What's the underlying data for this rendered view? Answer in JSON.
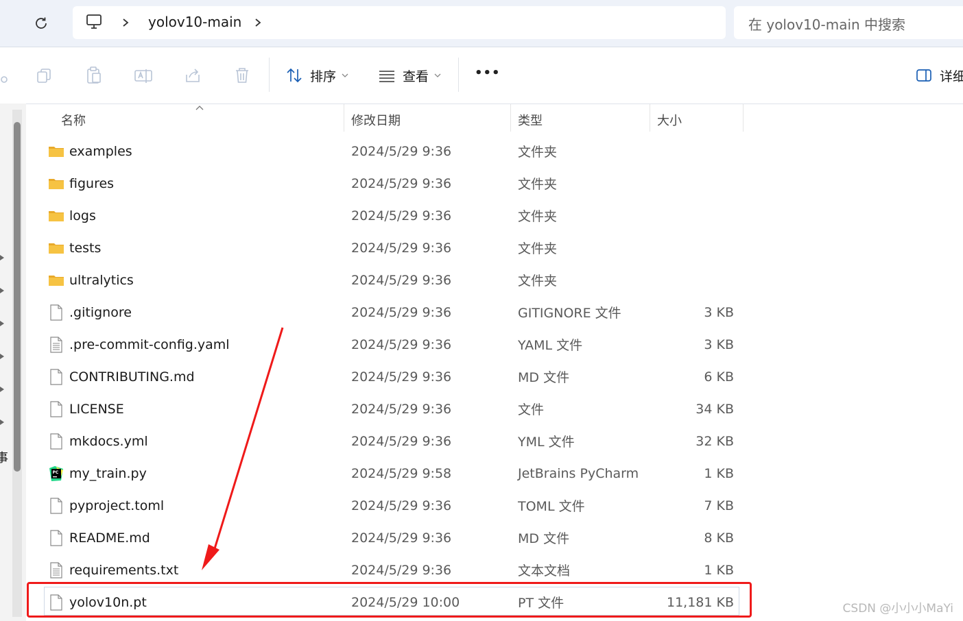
{
  "address": {
    "breadcrumb_folder": "yolov10-main",
    "search_placeholder": "在 yolov10-main 中搜索"
  },
  "toolbar": {
    "sort_label": "排序",
    "view_label": "查看",
    "more_label": "•••",
    "details_label": "详细"
  },
  "columns": {
    "name": "名称",
    "date": "修改日期",
    "type": "类型",
    "size": "大小"
  },
  "files": [
    {
      "name": "examples",
      "date": "2024/5/29 9:36",
      "type": "文件夹",
      "size": "",
      "icon": "folder-icon"
    },
    {
      "name": "figures",
      "date": "2024/5/29 9:36",
      "type": "文件夹",
      "size": "",
      "icon": "folder-icon"
    },
    {
      "name": "logs",
      "date": "2024/5/29 9:36",
      "type": "文件夹",
      "size": "",
      "icon": "folder-icon"
    },
    {
      "name": "tests",
      "date": "2024/5/29 9:36",
      "type": "文件夹",
      "size": "",
      "icon": "folder-icon"
    },
    {
      "name": "ultralytics",
      "date": "2024/5/29 9:36",
      "type": "文件夹",
      "size": "",
      "icon": "folder-icon"
    },
    {
      "name": ".gitignore",
      "date": "2024/5/29 9:36",
      "type": "GITIGNORE 文件",
      "size": "3 KB",
      "icon": "file-icon"
    },
    {
      "name": ".pre-commit-config.yaml",
      "date": "2024/5/29 9:36",
      "type": "YAML 文件",
      "size": "3 KB",
      "icon": "text-file-icon"
    },
    {
      "name": "CONTRIBUTING.md",
      "date": "2024/5/29 9:36",
      "type": "MD 文件",
      "size": "6 KB",
      "icon": "file-icon"
    },
    {
      "name": "LICENSE",
      "date": "2024/5/29 9:36",
      "type": "文件",
      "size": "34 KB",
      "icon": "file-icon"
    },
    {
      "name": "mkdocs.yml",
      "date": "2024/5/29 9:36",
      "type": "YML 文件",
      "size": "32 KB",
      "icon": "file-icon"
    },
    {
      "name": "my_train.py",
      "date": "2024/5/29 9:58",
      "type": "JetBrains PyCharm",
      "size": "1 KB",
      "icon": "pycharm-icon"
    },
    {
      "name": "pyproject.toml",
      "date": "2024/5/29 9:36",
      "type": "TOML 文件",
      "size": "7 KB",
      "icon": "file-icon"
    },
    {
      "name": "README.md",
      "date": "2024/5/29 9:36",
      "type": "MD 文件",
      "size": "8 KB",
      "icon": "file-icon"
    },
    {
      "name": "requirements.txt",
      "date": "2024/5/29 9:36",
      "type": "文本文档",
      "size": "1 KB",
      "icon": "text-file-icon"
    },
    {
      "name": "yolov10n.pt",
      "date": "2024/5/29 10:00",
      "type": "PT 文件",
      "size": "11,181 KB",
      "icon": "file-icon"
    }
  ],
  "left_pane": {
    "partial_label": "事"
  },
  "watermark": "CSDN @小小小MaYi",
  "colors": {
    "highlight": "#ef1a1a",
    "folder": "#f6c343",
    "address_bar_bg": "#eef2f9"
  }
}
